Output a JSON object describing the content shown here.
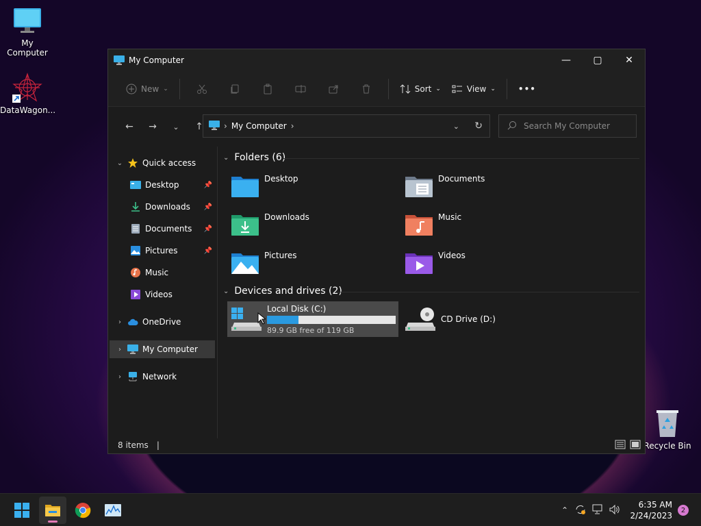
{
  "desktop": {
    "icons": [
      {
        "label": "My Computer"
      },
      {
        "label": "DataWagon..."
      },
      {
        "label": "Recycle Bin"
      }
    ]
  },
  "window": {
    "title": "My Computer",
    "toolbar": {
      "new_label": "New",
      "sort_label": "Sort",
      "view_label": "View",
      "more_label": "•••"
    },
    "address": {
      "crumb": "My Computer"
    },
    "search": {
      "placeholder": "Search My Computer"
    },
    "sidebar": {
      "quick_access": "Quick access",
      "items": [
        {
          "label": "Desktop"
        },
        {
          "label": "Downloads"
        },
        {
          "label": "Documents"
        },
        {
          "label": "Pictures"
        },
        {
          "label": "Music"
        },
        {
          "label": "Videos"
        }
      ],
      "onedrive": "OneDrive",
      "my_computer": "My Computer",
      "network": "Network"
    },
    "folders_header": "Folders (6)",
    "folders": [
      {
        "label": "Desktop"
      },
      {
        "label": "Documents"
      },
      {
        "label": "Downloads"
      },
      {
        "label": "Music"
      },
      {
        "label": "Pictures"
      },
      {
        "label": "Videos"
      }
    ],
    "drives_header": "Devices and drives (2)",
    "drives": [
      {
        "label": "Local Disk (C:)",
        "info": "89.9 GB free of 119 GB",
        "used_fraction": 0.245
      },
      {
        "label": "CD Drive (D:)"
      }
    ],
    "status": {
      "items": "8 items"
    }
  },
  "taskbar": {
    "time": "6:35 AM",
    "date": "2/24/2023",
    "notifications": "2"
  },
  "colors": {
    "accent": "#2a9ae0",
    "window_bg": "#1c1c1c",
    "selected_bg": "#393939"
  }
}
